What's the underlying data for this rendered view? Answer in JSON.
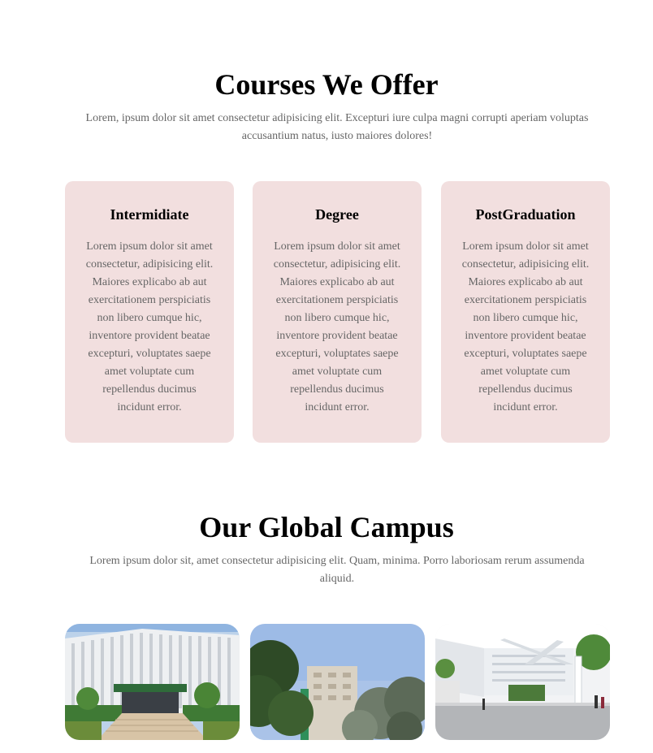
{
  "courses": {
    "title": "Courses We Offer",
    "description": "Lorem, ipsum dolor sit amet consectetur adipisicing elit. Excepturi iure culpa magni corrupti aperiam voluptas accusantium natus, iusto maiores dolores!",
    "cards": [
      {
        "title": "Intermidiate",
        "text": "Lorem ipsum dolor sit amet consectetur, adipisicing elit. Maiores explicabo ab aut exercitationem perspiciatis non libero cumque hic, inventore provident beatae excepturi, voluptates saepe amet voluptate cum repellendus ducimus incidunt error."
      },
      {
        "title": "Degree",
        "text": "Lorem ipsum dolor sit amet consectetur, adipisicing elit. Maiores explicabo ab aut exercitationem perspiciatis non libero cumque hic, inventore provident beatae excepturi, voluptates saepe amet voluptate cum repellendus ducimus incidunt error."
      },
      {
        "title": "PostGraduation",
        "text": "Lorem ipsum dolor sit amet consectetur, adipisicing elit. Maiores explicabo ab aut exercitationem perspiciatis non libero cumque hic, inventore provident beatae excepturi, voluptates saepe amet voluptate cum repellendus ducimus incidunt error."
      }
    ]
  },
  "campus": {
    "title": "Our Global Campus",
    "description": "Lorem ipsum dolor sit, amet consectetur adipisicing elit. Quam, minima. Porro laboriosam rerum assumenda aliquid."
  },
  "colors": {
    "card_background": "#f2dfdf",
    "heading": "#000000",
    "body_text": "#666666"
  }
}
